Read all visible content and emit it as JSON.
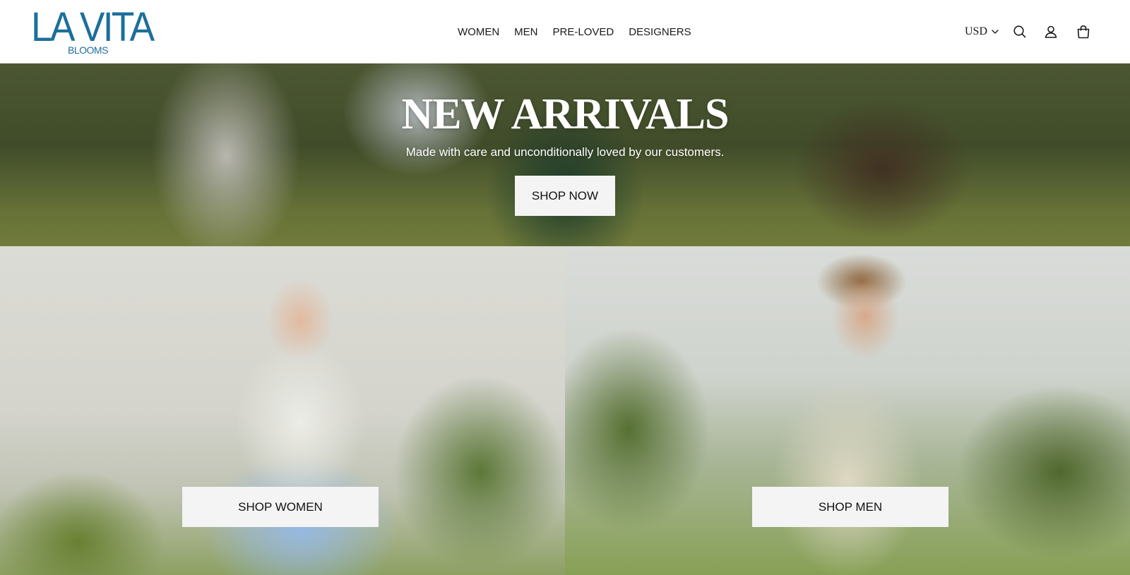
{
  "brand": {
    "name": "LA VITA",
    "tagline": "BLOOMS",
    "color": "#1d6f9b"
  },
  "nav": {
    "items": [
      {
        "label": "WOMEN"
      },
      {
        "label": "MEN"
      },
      {
        "label": "PRE-LOVED"
      },
      {
        "label": "DESIGNERS"
      }
    ]
  },
  "header_actions": {
    "currency": "USD",
    "icons": [
      "chevron-down-icon",
      "search-icon",
      "account-icon",
      "cart-icon"
    ]
  },
  "hero": {
    "title": "NEW ARRIVALS",
    "subtitle": "Made with care and unconditionally loved by our customers.",
    "button_label": "SHOP NOW"
  },
  "categories": [
    {
      "button_label": "SHOP WOMEN"
    },
    {
      "button_label": "SHOP MEN"
    }
  ]
}
